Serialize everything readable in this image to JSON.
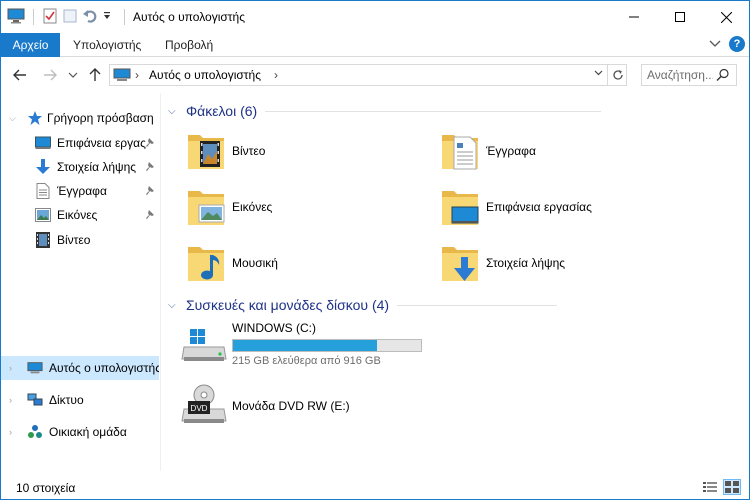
{
  "window": {
    "title": "Αυτός ο υπολογιστής"
  },
  "ribbon": {
    "tabs": [
      {
        "label": "Αρχείο"
      },
      {
        "label": "Υπολογιστής"
      },
      {
        "label": "Προβολή"
      }
    ],
    "help_label": "?"
  },
  "address": {
    "crumb": "Αυτός ο υπολογιστής"
  },
  "search": {
    "placeholder": "Αναζήτηση..."
  },
  "sidebar": {
    "quick_access": "Γρήγορη πρόσβαση",
    "items": [
      {
        "label": "Επιφάνεια εργας",
        "icon": "desktop-icon"
      },
      {
        "label": "Στοιχεία λήψης",
        "icon": "download-icon"
      },
      {
        "label": "Έγγραφα",
        "icon": "documents-icon"
      },
      {
        "label": "Εικόνες",
        "icon": "pictures-icon"
      },
      {
        "label": "Βίντεο",
        "icon": "video-icon"
      }
    ],
    "this_pc": "Αυτός ο υπολογιστής",
    "network": "Δίκτυο",
    "homegroup": "Οικιακή ομάδα"
  },
  "main": {
    "folders_header": "Φάκελοι (6)",
    "folders": [
      {
        "label": "Βίντεο",
        "icon": "video-folder-icon"
      },
      {
        "label": "Έγγραφα",
        "icon": "documents-folder-icon"
      },
      {
        "label": "Εικόνες",
        "icon": "pictures-folder-icon"
      },
      {
        "label": "Επιφάνεια εργασίας",
        "icon": "desktop-folder-icon"
      },
      {
        "label": "Μουσική",
        "icon": "music-folder-icon"
      },
      {
        "label": "Στοιχεία λήψης",
        "icon": "downloads-folder-icon"
      }
    ],
    "devices_header": "Συσκευές και μονάδες δίσκου (4)",
    "drives": [
      {
        "label": "WINDOWS (C:)",
        "free_text": "215 GB ελεύθερα από 916 GB",
        "used_fraction": 0.765
      },
      {
        "label": "Μονάδα DVD RW (E:)",
        "dvd_label": "DVD"
      }
    ]
  },
  "status": {
    "count": "10 στοιχεία"
  },
  "colors": {
    "accent": "#1979ca",
    "group_header": "#1e3287",
    "drive_bar": "#26a0da",
    "folder": "#f8d775",
    "selected": "#cce8ff"
  }
}
